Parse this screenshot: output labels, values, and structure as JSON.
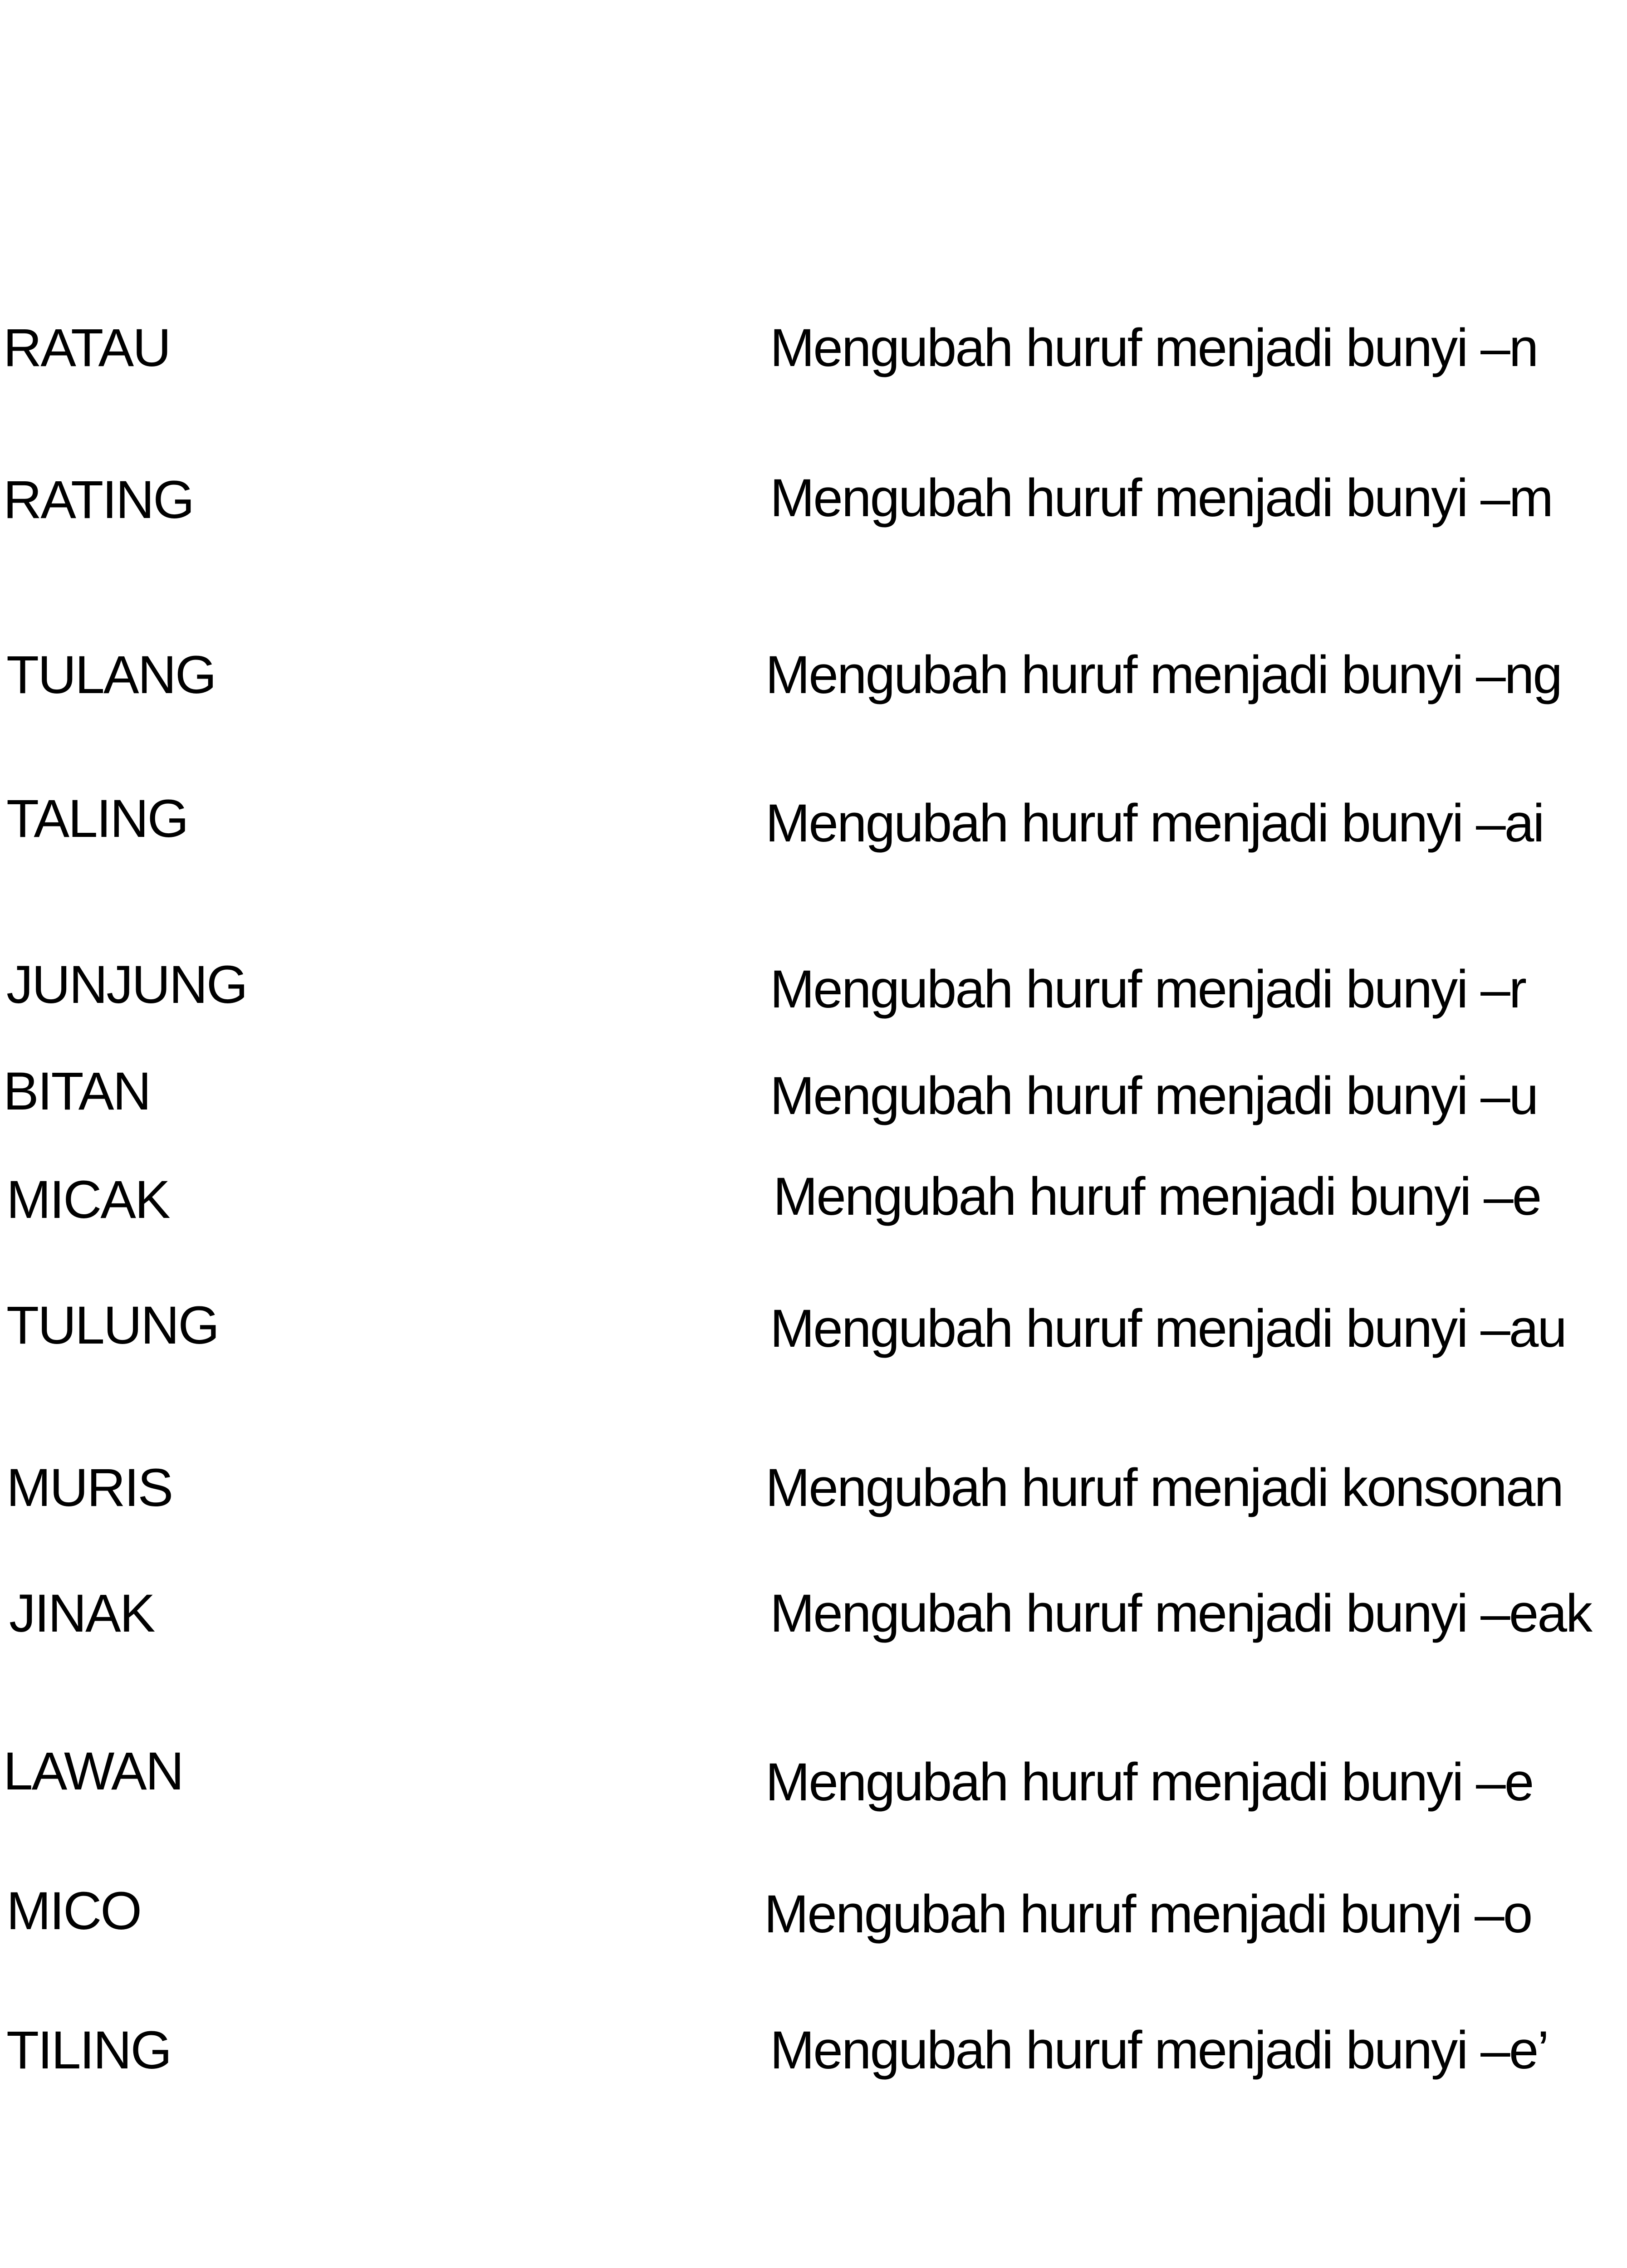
{
  "rows": [
    {
      "word": "RATAU",
      "rule": "Mengubah huruf menjadi bunyi –n"
    },
    {
      "word": "RATING",
      "rule": "Mengubah huruf menjadi bunyi –m"
    },
    {
      "word": "TULANG",
      "rule": "Mengubah huruf menjadi bunyi –ng"
    },
    {
      "word": "TALING",
      "rule": "Mengubah huruf menjadi bunyi –ai"
    },
    {
      "word": "JUNJUNG",
      "rule": "Mengubah huruf menjadi bunyi –r"
    },
    {
      "word": "BITAN",
      "rule": "Mengubah huruf menjadi bunyi –u"
    },
    {
      "word": "MICAK",
      "rule": "Mengubah huruf menjadi bunyi –e"
    },
    {
      "word": "TULUNG",
      "rule": "Mengubah huruf menjadi bunyi –au"
    },
    {
      "word": "MURIS",
      "rule": "Mengubah huruf menjadi konsonan"
    },
    {
      "word": "JINAK",
      "rule": "Mengubah huruf menjadi bunyi –eak"
    },
    {
      "word": "LAWAN",
      "rule": "Mengubah huruf menjadi bunyi –e"
    },
    {
      "word": "MICO",
      "rule": "Mengubah huruf menjadi bunyi –o"
    },
    {
      "word": "TILING",
      "rule": "Mengubah huruf menjadi bunyi –e’"
    }
  ]
}
